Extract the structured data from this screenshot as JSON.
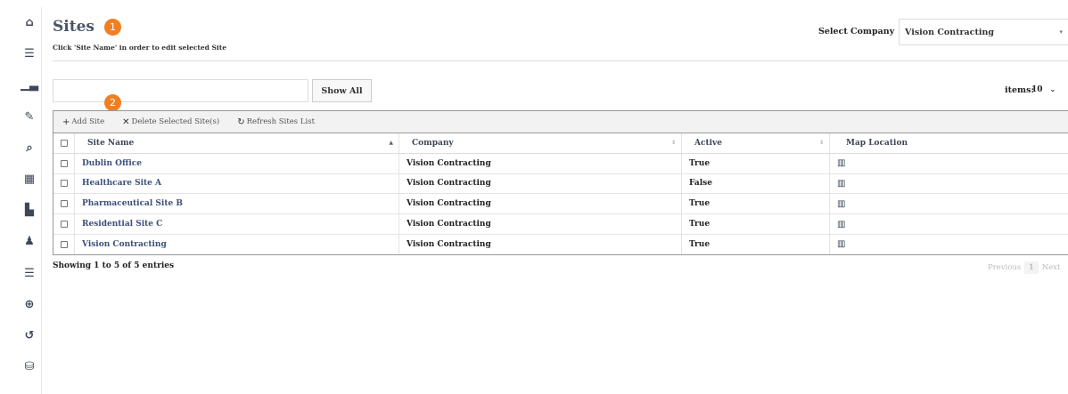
{
  "rail_icons": [
    {
      "name": "home-icon",
      "glyph": "⌂"
    },
    {
      "name": "list-icon",
      "glyph": "☰"
    },
    {
      "name": "bar-chart-icon",
      "glyph": "▁▃"
    },
    {
      "name": "pencil-icon",
      "glyph": "✎"
    },
    {
      "name": "search-icon",
      "glyph": "⌕"
    },
    {
      "name": "calculator-icon",
      "glyph": "▦"
    },
    {
      "name": "building-icon",
      "glyph": "▙"
    },
    {
      "name": "user-icon",
      "glyph": "♟"
    },
    {
      "name": "tasks-icon",
      "glyph": "☰"
    },
    {
      "name": "globe-icon",
      "glyph": "⊕"
    },
    {
      "name": "history-icon",
      "glyph": "↺"
    },
    {
      "name": "database-icon",
      "glyph": "⛁"
    }
  ],
  "header": {
    "title": "Sites",
    "subtitle": "Click 'Site Name' in order to edit selected Site",
    "markers": [
      "1",
      "2"
    ]
  },
  "company": {
    "label": "Select Company",
    "value": "Vision Contracting",
    "caret": "▾"
  },
  "search": {
    "placeholder": "",
    "show_all_label": "Show All"
  },
  "page_size": {
    "label": "items:",
    "value": "10",
    "caret": "⌄"
  },
  "toolbar": {
    "add": {
      "icon": "+",
      "label": "Add Site"
    },
    "delete": {
      "icon": "✕",
      "label": "Delete Selected Site(s)"
    },
    "refresh": {
      "icon": "↻",
      "label": "Refresh Sites List"
    }
  },
  "table": {
    "columns": [
      "Site Name",
      "Company",
      "Active",
      "Map Location"
    ],
    "sort_glyphs": {
      "asc": "▲",
      "none": "⇕"
    },
    "map_icon": "▥",
    "rows": [
      {
        "name": "Dublin Office",
        "company": "Vision Contracting",
        "active": "True"
      },
      {
        "name": "Healthcare Site A",
        "company": "Vision Contracting",
        "active": "False"
      },
      {
        "name": "Pharmaceutical Site B",
        "company": "Vision Contracting",
        "active": "True"
      },
      {
        "name": "Residential Site C",
        "company": "Vision Contracting",
        "active": "True"
      },
      {
        "name": "Vision Contracting",
        "company": "Vision Contracting",
        "active": "True"
      }
    ]
  },
  "footer": {
    "info": "Showing 1 to 5 of 5 entries",
    "previous": "Previous",
    "page": "1",
    "next": "Next"
  }
}
